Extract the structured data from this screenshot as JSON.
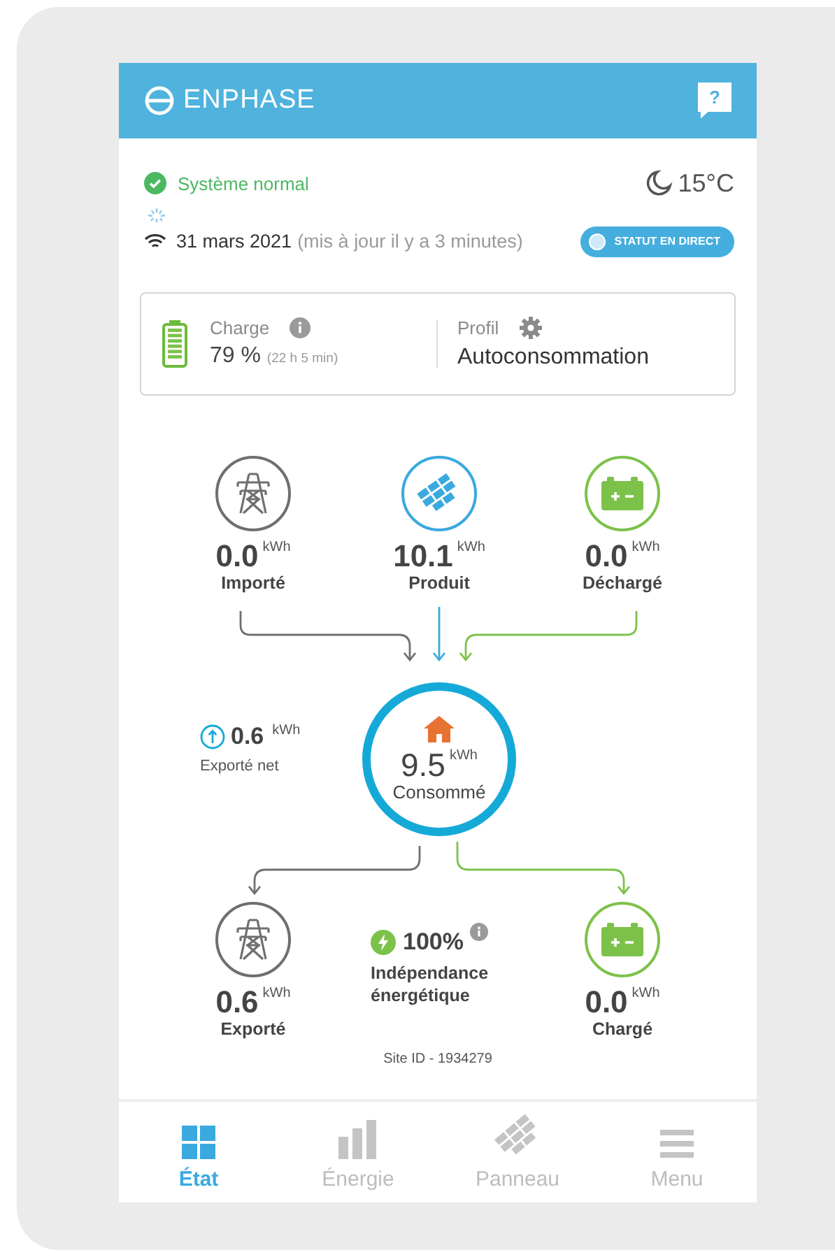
{
  "header": {
    "logo": "ENPHASE",
    "help": "?"
  },
  "status": {
    "label": "Système normal",
    "temperature": "15°C",
    "date": "31 mars 2021",
    "updated": "(mis à jour il y a 3 minutes)",
    "live_button": "STATUT EN DIRECT"
  },
  "battery_card": {
    "charge_label": "Charge",
    "charge_value": "79 %",
    "charge_time": "(22 h 5 min)",
    "profile_label": "Profil",
    "profile_value": "Autoconsommation"
  },
  "sources": [
    {
      "kind": "grid",
      "value": "0.0",
      "unit": "kWh",
      "label": "Importé"
    },
    {
      "kind": "solar",
      "value": "10.1",
      "unit": "kWh",
      "label": "Produit"
    },
    {
      "kind": "battery",
      "value": "0.0",
      "unit": "kWh",
      "label": "Déchargé"
    }
  ],
  "consumed": {
    "value": "9.5",
    "unit": "kWh",
    "label": "Consommé"
  },
  "net_export": {
    "value": "0.6",
    "unit": "kWh",
    "label": "Exporté net"
  },
  "independence": {
    "value": "100%",
    "label": "Indépendance énergétique"
  },
  "sinks": [
    {
      "kind": "grid",
      "value": "0.6",
      "unit": "kWh",
      "label": "Exporté"
    },
    {
      "kind": "battery",
      "value": "0.0",
      "unit": "kWh",
      "label": "Chargé"
    }
  ],
  "site_id": "Site ID - 1934279",
  "nav": [
    {
      "kind": "status",
      "label": "État",
      "selected": true
    },
    {
      "kind": "energy",
      "label": "Énergie",
      "selected": false
    },
    {
      "kind": "panels",
      "label": "Panneau",
      "selected": false
    },
    {
      "kind": "menu",
      "label": "Menu",
      "selected": false
    }
  ]
}
